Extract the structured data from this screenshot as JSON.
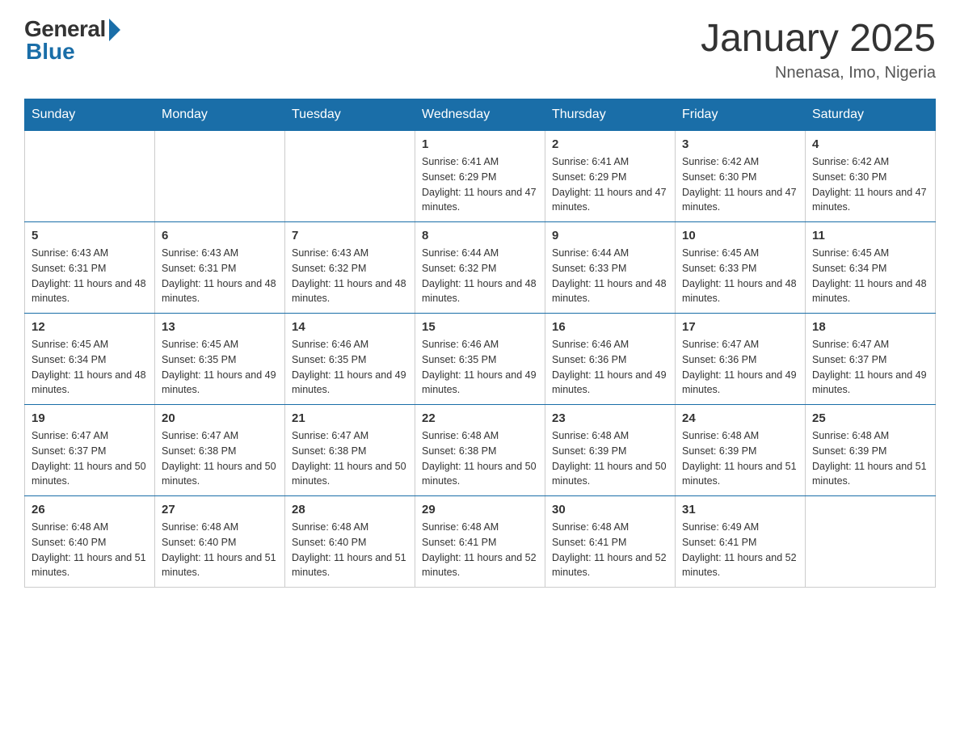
{
  "header": {
    "logo_general": "General",
    "logo_blue": "Blue",
    "month_title": "January 2025",
    "location": "Nnenasa, Imo, Nigeria"
  },
  "weekdays": [
    "Sunday",
    "Monday",
    "Tuesday",
    "Wednesday",
    "Thursday",
    "Friday",
    "Saturday"
  ],
  "weeks": [
    [
      {
        "day": "",
        "info": ""
      },
      {
        "day": "",
        "info": ""
      },
      {
        "day": "",
        "info": ""
      },
      {
        "day": "1",
        "info": "Sunrise: 6:41 AM\nSunset: 6:29 PM\nDaylight: 11 hours and 47 minutes."
      },
      {
        "day": "2",
        "info": "Sunrise: 6:41 AM\nSunset: 6:29 PM\nDaylight: 11 hours and 47 minutes."
      },
      {
        "day": "3",
        "info": "Sunrise: 6:42 AM\nSunset: 6:30 PM\nDaylight: 11 hours and 47 minutes."
      },
      {
        "day": "4",
        "info": "Sunrise: 6:42 AM\nSunset: 6:30 PM\nDaylight: 11 hours and 47 minutes."
      }
    ],
    [
      {
        "day": "5",
        "info": "Sunrise: 6:43 AM\nSunset: 6:31 PM\nDaylight: 11 hours and 48 minutes."
      },
      {
        "day": "6",
        "info": "Sunrise: 6:43 AM\nSunset: 6:31 PM\nDaylight: 11 hours and 48 minutes."
      },
      {
        "day": "7",
        "info": "Sunrise: 6:43 AM\nSunset: 6:32 PM\nDaylight: 11 hours and 48 minutes."
      },
      {
        "day": "8",
        "info": "Sunrise: 6:44 AM\nSunset: 6:32 PM\nDaylight: 11 hours and 48 minutes."
      },
      {
        "day": "9",
        "info": "Sunrise: 6:44 AM\nSunset: 6:33 PM\nDaylight: 11 hours and 48 minutes."
      },
      {
        "day": "10",
        "info": "Sunrise: 6:45 AM\nSunset: 6:33 PM\nDaylight: 11 hours and 48 minutes."
      },
      {
        "day": "11",
        "info": "Sunrise: 6:45 AM\nSunset: 6:34 PM\nDaylight: 11 hours and 48 minutes."
      }
    ],
    [
      {
        "day": "12",
        "info": "Sunrise: 6:45 AM\nSunset: 6:34 PM\nDaylight: 11 hours and 48 minutes."
      },
      {
        "day": "13",
        "info": "Sunrise: 6:45 AM\nSunset: 6:35 PM\nDaylight: 11 hours and 49 minutes."
      },
      {
        "day": "14",
        "info": "Sunrise: 6:46 AM\nSunset: 6:35 PM\nDaylight: 11 hours and 49 minutes."
      },
      {
        "day": "15",
        "info": "Sunrise: 6:46 AM\nSunset: 6:35 PM\nDaylight: 11 hours and 49 minutes."
      },
      {
        "day": "16",
        "info": "Sunrise: 6:46 AM\nSunset: 6:36 PM\nDaylight: 11 hours and 49 minutes."
      },
      {
        "day": "17",
        "info": "Sunrise: 6:47 AM\nSunset: 6:36 PM\nDaylight: 11 hours and 49 minutes."
      },
      {
        "day": "18",
        "info": "Sunrise: 6:47 AM\nSunset: 6:37 PM\nDaylight: 11 hours and 49 minutes."
      }
    ],
    [
      {
        "day": "19",
        "info": "Sunrise: 6:47 AM\nSunset: 6:37 PM\nDaylight: 11 hours and 50 minutes."
      },
      {
        "day": "20",
        "info": "Sunrise: 6:47 AM\nSunset: 6:38 PM\nDaylight: 11 hours and 50 minutes."
      },
      {
        "day": "21",
        "info": "Sunrise: 6:47 AM\nSunset: 6:38 PM\nDaylight: 11 hours and 50 minutes."
      },
      {
        "day": "22",
        "info": "Sunrise: 6:48 AM\nSunset: 6:38 PM\nDaylight: 11 hours and 50 minutes."
      },
      {
        "day": "23",
        "info": "Sunrise: 6:48 AM\nSunset: 6:39 PM\nDaylight: 11 hours and 50 minutes."
      },
      {
        "day": "24",
        "info": "Sunrise: 6:48 AM\nSunset: 6:39 PM\nDaylight: 11 hours and 51 minutes."
      },
      {
        "day": "25",
        "info": "Sunrise: 6:48 AM\nSunset: 6:39 PM\nDaylight: 11 hours and 51 minutes."
      }
    ],
    [
      {
        "day": "26",
        "info": "Sunrise: 6:48 AM\nSunset: 6:40 PM\nDaylight: 11 hours and 51 minutes."
      },
      {
        "day": "27",
        "info": "Sunrise: 6:48 AM\nSunset: 6:40 PM\nDaylight: 11 hours and 51 minutes."
      },
      {
        "day": "28",
        "info": "Sunrise: 6:48 AM\nSunset: 6:40 PM\nDaylight: 11 hours and 51 minutes."
      },
      {
        "day": "29",
        "info": "Sunrise: 6:48 AM\nSunset: 6:41 PM\nDaylight: 11 hours and 52 minutes."
      },
      {
        "day": "30",
        "info": "Sunrise: 6:48 AM\nSunset: 6:41 PM\nDaylight: 11 hours and 52 minutes."
      },
      {
        "day": "31",
        "info": "Sunrise: 6:49 AM\nSunset: 6:41 PM\nDaylight: 11 hours and 52 minutes."
      },
      {
        "day": "",
        "info": ""
      }
    ]
  ]
}
